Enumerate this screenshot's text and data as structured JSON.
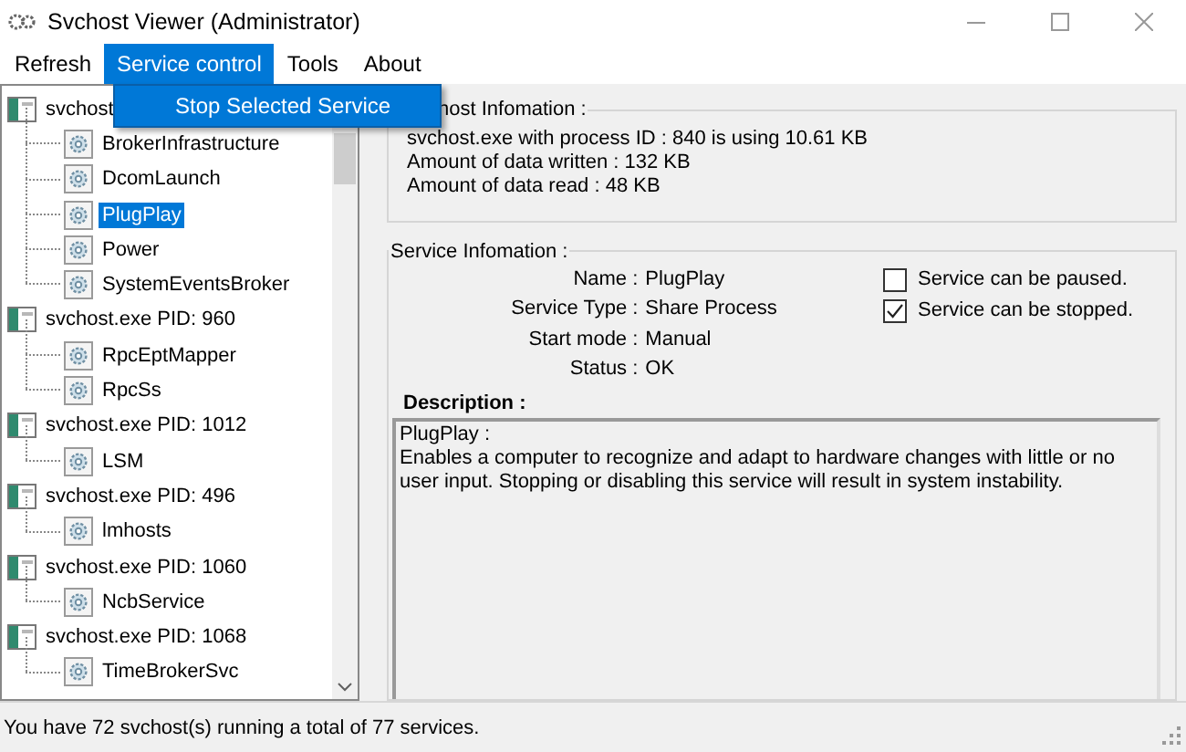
{
  "window": {
    "title": "Svchost Viewer (Administrator)"
  },
  "menu": [
    {
      "label": "Refresh",
      "selected": false
    },
    {
      "label": "Service control",
      "selected": true
    },
    {
      "label": "Tools",
      "selected": false
    },
    {
      "label": "About",
      "selected": false
    }
  ],
  "dropdown": {
    "items": [
      {
        "label": "Stop Selected Service",
        "selected": true
      }
    ]
  },
  "tree": [
    {
      "label": "svchost",
      "selected": false,
      "children": [
        {
          "label": "BrokerInfrastructure",
          "selected": false
        },
        {
          "label": "DcomLaunch",
          "selected": false
        },
        {
          "label": "PlugPlay",
          "selected": true
        },
        {
          "label": "Power",
          "selected": false
        },
        {
          "label": "SystemEventsBroker",
          "selected": false
        }
      ]
    },
    {
      "label": "svchost.exe PID: 960",
      "selected": false,
      "children": [
        {
          "label": "RpcEptMapper",
          "selected": false
        },
        {
          "label": "RpcSs",
          "selected": false
        }
      ]
    },
    {
      "label": "svchost.exe PID: 1012",
      "selected": false,
      "children": [
        {
          "label": "LSM",
          "selected": false
        }
      ]
    },
    {
      "label": "svchost.exe PID: 496",
      "selected": false,
      "children": [
        {
          "label": "lmhosts",
          "selected": false
        }
      ]
    },
    {
      "label": "svchost.exe PID: 1060",
      "selected": false,
      "children": [
        {
          "label": "NcbService",
          "selected": false
        }
      ]
    },
    {
      "label": "svchost.exe PID: 1068",
      "selected": false,
      "children": [
        {
          "label": "TimeBrokerSvc",
          "selected": false
        }
      ]
    }
  ],
  "svchost_info": {
    "title": "host Infomation :",
    "lines": [
      "svchost.exe with process ID : 840 is using 10.61 KB",
      "Amount of data written : 132 KB",
      "Amount of data read : 48 KB"
    ]
  },
  "service_info": {
    "title": "Service Infomation :",
    "fields": [
      {
        "label": "Name :",
        "value": "PlugPlay"
      },
      {
        "label": "Service Type :",
        "value": "Share Process"
      },
      {
        "label": "Start mode :",
        "value": "Manual"
      },
      {
        "label": "Status :",
        "value": "OK"
      }
    ],
    "options": [
      {
        "label": "Service can be paused.",
        "checked": false
      },
      {
        "label": "Service can be stopped.",
        "checked": true
      }
    ],
    "description_label": "Description :",
    "description": [
      "PlugPlay :",
      "Enables a computer to recognize and adapt to hardware changes with little or no user input. Stopping or disabling this service will result in system instability."
    ]
  },
  "status_bar": "You have 72 svchost(s) running a total of 77 services."
}
